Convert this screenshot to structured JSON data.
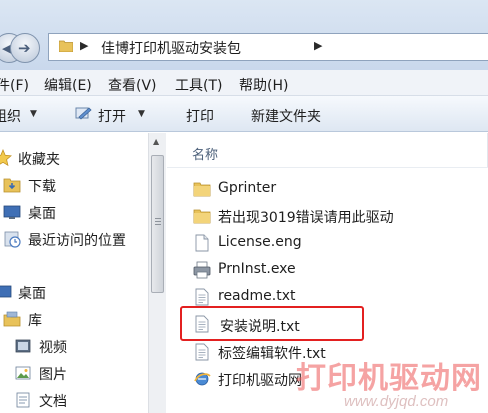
{
  "address_bar": {
    "breadcrumb": "佳博打印机驱动安装包"
  },
  "menu": {
    "items": [
      "件(F)",
      "编辑(E)",
      "查看(V)",
      "工具(T)",
      "帮助(H)"
    ]
  },
  "toolbar": {
    "organize_label": "组织",
    "open_label": "打开",
    "print_label": "打印",
    "new_folder_label": "新建文件夹"
  },
  "nav_pane": {
    "favorites_label": "收藏夹",
    "downloads_label": "下载",
    "desktop_label": "桌面",
    "recent_label": "最近访问的位置",
    "desktop_root_label": "桌面",
    "libraries_label": "库",
    "videos_label": "视频",
    "pictures_label": "图片",
    "documents_label": "文档"
  },
  "file_list": {
    "column_header": "名称",
    "items": [
      {
        "name": "Gprinter",
        "icon": "folder-icon"
      },
      {
        "name": "若出现3019错误请用此驱动",
        "icon": "folder-icon"
      },
      {
        "name": "License.eng",
        "icon": "file-icon"
      },
      {
        "name": "PrnInst.exe",
        "icon": "printer-exe-icon"
      },
      {
        "name": "readme.txt",
        "icon": "text-file-icon"
      },
      {
        "name": "安装说明.txt",
        "icon": "text-file-icon"
      },
      {
        "name": "标签编辑软件.txt",
        "icon": "text-file-icon"
      },
      {
        "name": "打印机驱动网",
        "icon": "internet-shortcut-icon"
      }
    ],
    "selected_index": 5
  },
  "watermark": {
    "title": "打印机驱动网",
    "url": "www.dyjqd.com"
  },
  "colors": {
    "selection_outline": "#e32020",
    "folder": "#e8c25a",
    "header_text": "#4c607a"
  }
}
